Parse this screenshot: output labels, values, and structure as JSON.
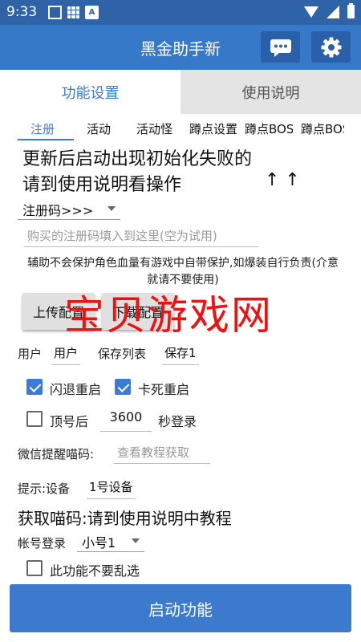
{
  "status_bar": {
    "time": "9:33",
    "left_icons": [
      "square-icon",
      "grid-icon",
      "a-icon"
    ],
    "right_icons": [
      "wifi-icon",
      "signal-icon",
      "battery-icon"
    ]
  },
  "header": {
    "title": "黑金助手新",
    "background_color": "#3779c9",
    "icons": [
      "chat-icon",
      "gear-icon"
    ]
  },
  "main_tabs": [
    {
      "label": "功能设置",
      "active": true
    },
    {
      "label": "使用说明",
      "active": false
    }
  ],
  "sub_tabs": [
    {
      "label": "注册",
      "active": true
    },
    {
      "label": "活动",
      "active": false
    },
    {
      "label": "活动怪",
      "active": false
    },
    {
      "label": "蹲点设置",
      "active": false
    },
    {
      "label": "蹲点BOSS",
      "active": false
    },
    {
      "label": "蹲点BOSS",
      "active": false
    }
  ],
  "notice": {
    "line1": "更新后启动出现初始化失败的",
    "line2": "请到使用说明看操作",
    "arrows": "↑ ↑"
  },
  "register": {
    "dropdown_value": "注册码>>>",
    "input_value": "",
    "input_placeholder": "购买的注册码填入到这里(空为试用)"
  },
  "warning": "辅助不会保护角色血量有游戏中自带保护,如爆装自行负责(介意就请不要使用)",
  "config_buttons": {
    "upload": "上传配置",
    "download": "下载配置"
  },
  "watermark": "宝贝游戏网",
  "user_row": {
    "user_label": "用户",
    "user_value": "用户",
    "save_list_label": "保存列表",
    "save_value": "保存1"
  },
  "checks": {
    "crash_restart": {
      "label": "闪退重启",
      "checked": true
    },
    "freeze_restart": {
      "label": "卡死重启",
      "checked": true
    },
    "relogin": {
      "label_before": "顶号后",
      "value": "3600",
      "label_after": "秒登录",
      "checked": false
    }
  },
  "wechat": {
    "label": "微信提醒喵码:",
    "input_value": "",
    "input_placeholder": "查看教程获取"
  },
  "device": {
    "label": "提示:设备",
    "value": "1号设备"
  },
  "get_code_title": "获取喵码:请到使用说明中教程",
  "account": {
    "label": "帐号登录",
    "value": "小号1"
  },
  "no_random": {
    "label": "此功能不要乱选",
    "checked": false
  },
  "start_button": "启动功能",
  "colors": {
    "accent": "#3a7bd5",
    "status_bar": "#2e63a8",
    "watermark": "#ee1111"
  }
}
